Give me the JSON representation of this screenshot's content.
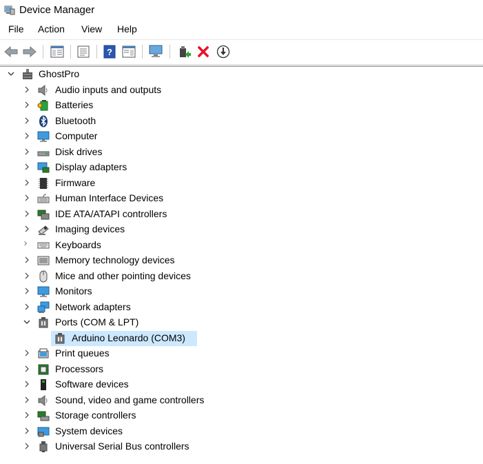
{
  "window": {
    "title": "Device Manager"
  },
  "menu": [
    "File",
    "Action",
    "View",
    "Help"
  ],
  "toolbar": [
    "back-icon",
    "forward-icon",
    "properties-pane-icon",
    "console-tree-icon",
    "help-icon",
    "action-pane-icon",
    "scan-hardware-icon",
    "update-driver-icon",
    "uninstall-icon",
    "disable-icon"
  ],
  "tree": {
    "root": {
      "label": "GhostPro",
      "icon": "computer-root-icon"
    },
    "categories": [
      {
        "label": "Audio inputs and outputs",
        "icon": "speaker-icon"
      },
      {
        "label": "Batteries",
        "icon": "battery-icon"
      },
      {
        "label": "Bluetooth",
        "icon": "bluetooth-icon"
      },
      {
        "label": "Computer",
        "icon": "monitor-icon"
      },
      {
        "label": "Disk drives",
        "icon": "disk-icon"
      },
      {
        "label": "Display adapters",
        "icon": "display-adapter-icon"
      },
      {
        "label": "Firmware",
        "icon": "firmware-icon"
      },
      {
        "label": "Human Interface Devices",
        "icon": "hid-icon"
      },
      {
        "label": "IDE ATA/ATAPI controllers",
        "icon": "ide-icon"
      },
      {
        "label": "Imaging devices",
        "icon": "camera-icon"
      },
      {
        "label": "Keyboards",
        "icon": "keyboard-icon"
      },
      {
        "label": "Memory technology devices",
        "icon": "memory-icon"
      },
      {
        "label": "Mice and other pointing devices",
        "icon": "mouse-icon"
      },
      {
        "label": "Monitors",
        "icon": "monitor-icon"
      },
      {
        "label": "Network adapters",
        "icon": "network-icon"
      },
      {
        "label": "Ports (COM & LPT)",
        "icon": "port-icon",
        "expanded": true,
        "children": [
          {
            "label": "Arduino Leonardo (COM3)",
            "icon": "port-icon",
            "selected": true
          }
        ]
      },
      {
        "label": "Print queues",
        "icon": "printer-icon"
      },
      {
        "label": "Processors",
        "icon": "processor-icon"
      },
      {
        "label": "Software devices",
        "icon": "software-device-icon"
      },
      {
        "label": "Sound, video and game controllers",
        "icon": "speaker-icon"
      },
      {
        "label": "Storage controllers",
        "icon": "storage-icon"
      },
      {
        "label": "System devices",
        "icon": "system-icon"
      },
      {
        "label": "Universal Serial Bus controllers",
        "icon": "usb-icon"
      }
    ]
  },
  "colors": {
    "selection": "#cce8ff",
    "accent": "#1e6bb8",
    "uninstall": "#e81123"
  }
}
